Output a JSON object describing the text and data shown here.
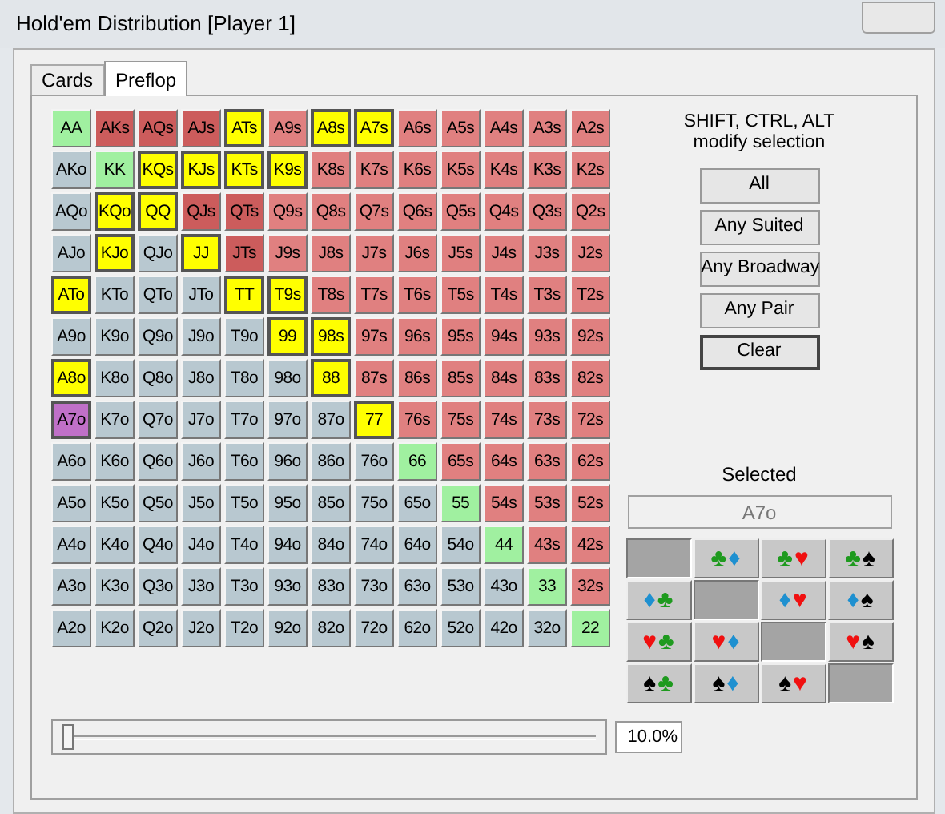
{
  "window": {
    "title": "Hold'em Distribution [Player 1]"
  },
  "tabs": [
    {
      "label": "Cards",
      "selected": false
    },
    {
      "label": "Preflop",
      "selected": true
    }
  ],
  "hand_grid": [
    [
      {
        "label": "AA",
        "color": "#a0f0a0",
        "selected": false
      },
      {
        "label": "AKs",
        "color": "#cc5c5c",
        "selected": false
      },
      {
        "label": "AQs",
        "color": "#cc5c5c",
        "selected": false
      },
      {
        "label": "AJs",
        "color": "#cc5c5c",
        "selected": false
      },
      {
        "label": "ATs",
        "color": "#ffff00",
        "selected": true
      },
      {
        "label": "A9s",
        "color": "#e08080",
        "selected": false
      },
      {
        "label": "A8s",
        "color": "#ffff00",
        "selected": true
      },
      {
        "label": "A7s",
        "color": "#ffff00",
        "selected": true
      },
      {
        "label": "A6s",
        "color": "#e08080",
        "selected": false
      },
      {
        "label": "A5s",
        "color": "#e08080",
        "selected": false
      },
      {
        "label": "A4s",
        "color": "#e08080",
        "selected": false
      },
      {
        "label": "A3s",
        "color": "#e08080",
        "selected": false
      },
      {
        "label": "A2s",
        "color": "#e08080",
        "selected": false
      }
    ],
    [
      {
        "label": "AKo",
        "color": "#b8c8d0",
        "selected": false
      },
      {
        "label": "KK",
        "color": "#a0f0a0",
        "selected": false
      },
      {
        "label": "KQs",
        "color": "#ffff00",
        "selected": true
      },
      {
        "label": "KJs",
        "color": "#ffff00",
        "selected": true
      },
      {
        "label": "KTs",
        "color": "#ffff00",
        "selected": true
      },
      {
        "label": "K9s",
        "color": "#ffff00",
        "selected": true
      },
      {
        "label": "K8s",
        "color": "#e08080",
        "selected": false
      },
      {
        "label": "K7s",
        "color": "#e08080",
        "selected": false
      },
      {
        "label": "K6s",
        "color": "#e08080",
        "selected": false
      },
      {
        "label": "K5s",
        "color": "#e08080",
        "selected": false
      },
      {
        "label": "K4s",
        "color": "#e08080",
        "selected": false
      },
      {
        "label": "K3s",
        "color": "#e08080",
        "selected": false
      },
      {
        "label": "K2s",
        "color": "#e08080",
        "selected": false
      }
    ],
    [
      {
        "label": "AQo",
        "color": "#b8c8d0",
        "selected": false
      },
      {
        "label": "KQo",
        "color": "#ffff00",
        "selected": true
      },
      {
        "label": "QQ",
        "color": "#ffff00",
        "selected": true
      },
      {
        "label": "QJs",
        "color": "#cc5c5c",
        "selected": false
      },
      {
        "label": "QTs",
        "color": "#cc5c5c",
        "selected": false
      },
      {
        "label": "Q9s",
        "color": "#e08080",
        "selected": false
      },
      {
        "label": "Q8s",
        "color": "#e08080",
        "selected": false
      },
      {
        "label": "Q7s",
        "color": "#e08080",
        "selected": false
      },
      {
        "label": "Q6s",
        "color": "#e08080",
        "selected": false
      },
      {
        "label": "Q5s",
        "color": "#e08080",
        "selected": false
      },
      {
        "label": "Q4s",
        "color": "#e08080",
        "selected": false
      },
      {
        "label": "Q3s",
        "color": "#e08080",
        "selected": false
      },
      {
        "label": "Q2s",
        "color": "#e08080",
        "selected": false
      }
    ],
    [
      {
        "label": "AJo",
        "color": "#b8c8d0",
        "selected": false
      },
      {
        "label": "KJo",
        "color": "#ffff00",
        "selected": true
      },
      {
        "label": "QJo",
        "color": "#b8c8d0",
        "selected": false
      },
      {
        "label": "JJ",
        "color": "#ffff00",
        "selected": true
      },
      {
        "label": "JTs",
        "color": "#cc5c5c",
        "selected": false
      },
      {
        "label": "J9s",
        "color": "#e08080",
        "selected": false
      },
      {
        "label": "J8s",
        "color": "#e08080",
        "selected": false
      },
      {
        "label": "J7s",
        "color": "#e08080",
        "selected": false
      },
      {
        "label": "J6s",
        "color": "#e08080",
        "selected": false
      },
      {
        "label": "J5s",
        "color": "#e08080",
        "selected": false
      },
      {
        "label": "J4s",
        "color": "#e08080",
        "selected": false
      },
      {
        "label": "J3s",
        "color": "#e08080",
        "selected": false
      },
      {
        "label": "J2s",
        "color": "#e08080",
        "selected": false
      }
    ],
    [
      {
        "label": "ATo",
        "color": "#ffff00",
        "selected": true
      },
      {
        "label": "KTo",
        "color": "#b8c8d0",
        "selected": false
      },
      {
        "label": "QTo",
        "color": "#b8c8d0",
        "selected": false
      },
      {
        "label": "JTo",
        "color": "#b8c8d0",
        "selected": false
      },
      {
        "label": "TT",
        "color": "#ffff00",
        "selected": true
      },
      {
        "label": "T9s",
        "color": "#ffff00",
        "selected": true
      },
      {
        "label": "T8s",
        "color": "#e08080",
        "selected": false
      },
      {
        "label": "T7s",
        "color": "#e08080",
        "selected": false
      },
      {
        "label": "T6s",
        "color": "#e08080",
        "selected": false
      },
      {
        "label": "T5s",
        "color": "#e08080",
        "selected": false
      },
      {
        "label": "T4s",
        "color": "#e08080",
        "selected": false
      },
      {
        "label": "T3s",
        "color": "#e08080",
        "selected": false
      },
      {
        "label": "T2s",
        "color": "#e08080",
        "selected": false
      }
    ],
    [
      {
        "label": "A9o",
        "color": "#b8c8d0",
        "selected": false
      },
      {
        "label": "K9o",
        "color": "#b8c8d0",
        "selected": false
      },
      {
        "label": "Q9o",
        "color": "#b8c8d0",
        "selected": false
      },
      {
        "label": "J9o",
        "color": "#b8c8d0",
        "selected": false
      },
      {
        "label": "T9o",
        "color": "#b8c8d0",
        "selected": false
      },
      {
        "label": "99",
        "color": "#ffff00",
        "selected": true
      },
      {
        "label": "98s",
        "color": "#ffff00",
        "selected": true
      },
      {
        "label": "97s",
        "color": "#e08080",
        "selected": false
      },
      {
        "label": "96s",
        "color": "#e08080",
        "selected": false
      },
      {
        "label": "95s",
        "color": "#e08080",
        "selected": false
      },
      {
        "label": "94s",
        "color": "#e08080",
        "selected": false
      },
      {
        "label": "93s",
        "color": "#e08080",
        "selected": false
      },
      {
        "label": "92s",
        "color": "#e08080",
        "selected": false
      }
    ],
    [
      {
        "label": "A8o",
        "color": "#ffff00",
        "selected": true
      },
      {
        "label": "K8o",
        "color": "#b8c8d0",
        "selected": false
      },
      {
        "label": "Q8o",
        "color": "#b8c8d0",
        "selected": false
      },
      {
        "label": "J8o",
        "color": "#b8c8d0",
        "selected": false
      },
      {
        "label": "T8o",
        "color": "#b8c8d0",
        "selected": false
      },
      {
        "label": "98o",
        "color": "#b8c8d0",
        "selected": false
      },
      {
        "label": "88",
        "color": "#ffff00",
        "selected": true
      },
      {
        "label": "87s",
        "color": "#e08080",
        "selected": false
      },
      {
        "label": "86s",
        "color": "#e08080",
        "selected": false
      },
      {
        "label": "85s",
        "color": "#e08080",
        "selected": false
      },
      {
        "label": "84s",
        "color": "#e08080",
        "selected": false
      },
      {
        "label": "83s",
        "color": "#e08080",
        "selected": false
      },
      {
        "label": "82s",
        "color": "#e08080",
        "selected": false
      }
    ],
    [
      {
        "label": "A7o",
        "color": "#c070c8",
        "selected": true
      },
      {
        "label": "K7o",
        "color": "#b8c8d0",
        "selected": false
      },
      {
        "label": "Q7o",
        "color": "#b8c8d0",
        "selected": false
      },
      {
        "label": "J7o",
        "color": "#b8c8d0",
        "selected": false
      },
      {
        "label": "T7o",
        "color": "#b8c8d0",
        "selected": false
      },
      {
        "label": "97o",
        "color": "#b8c8d0",
        "selected": false
      },
      {
        "label": "87o",
        "color": "#b8c8d0",
        "selected": false
      },
      {
        "label": "77",
        "color": "#ffff00",
        "selected": true
      },
      {
        "label": "76s",
        "color": "#e08080",
        "selected": false
      },
      {
        "label": "75s",
        "color": "#e08080",
        "selected": false
      },
      {
        "label": "74s",
        "color": "#e08080",
        "selected": false
      },
      {
        "label": "73s",
        "color": "#e08080",
        "selected": false
      },
      {
        "label": "72s",
        "color": "#e08080",
        "selected": false
      }
    ],
    [
      {
        "label": "A6o",
        "color": "#b8c8d0",
        "selected": false
      },
      {
        "label": "K6o",
        "color": "#b8c8d0",
        "selected": false
      },
      {
        "label": "Q6o",
        "color": "#b8c8d0",
        "selected": false
      },
      {
        "label": "J6o",
        "color": "#b8c8d0",
        "selected": false
      },
      {
        "label": "T6o",
        "color": "#b8c8d0",
        "selected": false
      },
      {
        "label": "96o",
        "color": "#b8c8d0",
        "selected": false
      },
      {
        "label": "86o",
        "color": "#b8c8d0",
        "selected": false
      },
      {
        "label": "76o",
        "color": "#b8c8d0",
        "selected": false
      },
      {
        "label": "66",
        "color": "#a0f0a0",
        "selected": false
      },
      {
        "label": "65s",
        "color": "#e08080",
        "selected": false
      },
      {
        "label": "64s",
        "color": "#e08080",
        "selected": false
      },
      {
        "label": "63s",
        "color": "#e08080",
        "selected": false
      },
      {
        "label": "62s",
        "color": "#e08080",
        "selected": false
      }
    ],
    [
      {
        "label": "A5o",
        "color": "#b8c8d0",
        "selected": false
      },
      {
        "label": "K5o",
        "color": "#b8c8d0",
        "selected": false
      },
      {
        "label": "Q5o",
        "color": "#b8c8d0",
        "selected": false
      },
      {
        "label": "J5o",
        "color": "#b8c8d0",
        "selected": false
      },
      {
        "label": "T5o",
        "color": "#b8c8d0",
        "selected": false
      },
      {
        "label": "95o",
        "color": "#b8c8d0",
        "selected": false
      },
      {
        "label": "85o",
        "color": "#b8c8d0",
        "selected": false
      },
      {
        "label": "75o",
        "color": "#b8c8d0",
        "selected": false
      },
      {
        "label": "65o",
        "color": "#b8c8d0",
        "selected": false
      },
      {
        "label": "55",
        "color": "#a0f0a0",
        "selected": false
      },
      {
        "label": "54s",
        "color": "#e08080",
        "selected": false
      },
      {
        "label": "53s",
        "color": "#e08080",
        "selected": false
      },
      {
        "label": "52s",
        "color": "#e08080",
        "selected": false
      }
    ],
    [
      {
        "label": "A4o",
        "color": "#b8c8d0",
        "selected": false
      },
      {
        "label": "K4o",
        "color": "#b8c8d0",
        "selected": false
      },
      {
        "label": "Q4o",
        "color": "#b8c8d0",
        "selected": false
      },
      {
        "label": "J4o",
        "color": "#b8c8d0",
        "selected": false
      },
      {
        "label": "T4o",
        "color": "#b8c8d0",
        "selected": false
      },
      {
        "label": "94o",
        "color": "#b8c8d0",
        "selected": false
      },
      {
        "label": "84o",
        "color": "#b8c8d0",
        "selected": false
      },
      {
        "label": "74o",
        "color": "#b8c8d0",
        "selected": false
      },
      {
        "label": "64o",
        "color": "#b8c8d0",
        "selected": false
      },
      {
        "label": "54o",
        "color": "#b8c8d0",
        "selected": false
      },
      {
        "label": "44",
        "color": "#a0f0a0",
        "selected": false
      },
      {
        "label": "43s",
        "color": "#e08080",
        "selected": false
      },
      {
        "label": "42s",
        "color": "#e08080",
        "selected": false
      }
    ],
    [
      {
        "label": "A3o",
        "color": "#b8c8d0",
        "selected": false
      },
      {
        "label": "K3o",
        "color": "#b8c8d0",
        "selected": false
      },
      {
        "label": "Q3o",
        "color": "#b8c8d0",
        "selected": false
      },
      {
        "label": "J3o",
        "color": "#b8c8d0",
        "selected": false
      },
      {
        "label": "T3o",
        "color": "#b8c8d0",
        "selected": false
      },
      {
        "label": "93o",
        "color": "#b8c8d0",
        "selected": false
      },
      {
        "label": "83o",
        "color": "#b8c8d0",
        "selected": false
      },
      {
        "label": "73o",
        "color": "#b8c8d0",
        "selected": false
      },
      {
        "label": "63o",
        "color": "#b8c8d0",
        "selected": false
      },
      {
        "label": "53o",
        "color": "#b8c8d0",
        "selected": false
      },
      {
        "label": "43o",
        "color": "#b8c8d0",
        "selected": false
      },
      {
        "label": "33",
        "color": "#a0f0a0",
        "selected": false
      },
      {
        "label": "32s",
        "color": "#e08080",
        "selected": false
      }
    ],
    [
      {
        "label": "A2o",
        "color": "#b8c8d0",
        "selected": false
      },
      {
        "label": "K2o",
        "color": "#b8c8d0",
        "selected": false
      },
      {
        "label": "Q2o",
        "color": "#b8c8d0",
        "selected": false
      },
      {
        "label": "J2o",
        "color": "#b8c8d0",
        "selected": false
      },
      {
        "label": "T2o",
        "color": "#b8c8d0",
        "selected": false
      },
      {
        "label": "92o",
        "color": "#b8c8d0",
        "selected": false
      },
      {
        "label": "82o",
        "color": "#b8c8d0",
        "selected": false
      },
      {
        "label": "72o",
        "color": "#b8c8d0",
        "selected": false
      },
      {
        "label": "62o",
        "color": "#b8c8d0",
        "selected": false
      },
      {
        "label": "52o",
        "color": "#b8c8d0",
        "selected": false
      },
      {
        "label": "42o",
        "color": "#b8c8d0",
        "selected": false
      },
      {
        "label": "32o",
        "color": "#b8c8d0",
        "selected": false
      },
      {
        "label": "22",
        "color": "#a0f0a0",
        "selected": false
      }
    ]
  ],
  "hint": {
    "line_1": "SHIFT, CTRL, ALT",
    "line_2": "modify selection"
  },
  "buttons": [
    {
      "label": "All",
      "selected": false
    },
    {
      "label": "Any Suited",
      "selected": false
    },
    {
      "label": "Any Broadway",
      "selected": false
    },
    {
      "label": "Any Pair",
      "selected": false
    },
    {
      "label": "Clear",
      "selected": true
    }
  ],
  "selected_label": "Selected",
  "selected_value": "A7o",
  "suit_grid": [
    [
      {
        "kind": "empty"
      },
      {
        "kind": "combo",
        "suits": [
          {
            "symbol": "♣",
            "color": "#1e9a1e"
          },
          {
            "symbol": "♦",
            "color": "#1e90d0"
          }
        ]
      },
      {
        "kind": "combo",
        "suits": [
          {
            "symbol": "♣",
            "color": "#1e9a1e"
          },
          {
            "symbol": "♥",
            "color": "#f01010"
          }
        ]
      },
      {
        "kind": "combo",
        "suits": [
          {
            "symbol": "♣",
            "color": "#1e9a1e"
          },
          {
            "symbol": "♠",
            "color": "#000000"
          }
        ]
      }
    ],
    [
      {
        "kind": "combo",
        "suits": [
          {
            "symbol": "♦",
            "color": "#1e90d0"
          },
          {
            "symbol": "♣",
            "color": "#1e9a1e"
          }
        ]
      },
      {
        "kind": "empty"
      },
      {
        "kind": "combo",
        "suits": [
          {
            "symbol": "♦",
            "color": "#1e90d0"
          },
          {
            "symbol": "♥",
            "color": "#f01010"
          }
        ]
      },
      {
        "kind": "combo",
        "suits": [
          {
            "symbol": "♦",
            "color": "#1e90d0"
          },
          {
            "symbol": "♠",
            "color": "#000000"
          }
        ]
      }
    ],
    [
      {
        "kind": "combo",
        "suits": [
          {
            "symbol": "♥",
            "color": "#f01010"
          },
          {
            "symbol": "♣",
            "color": "#1e9a1e"
          }
        ]
      },
      {
        "kind": "combo",
        "suits": [
          {
            "symbol": "♥",
            "color": "#f01010"
          },
          {
            "symbol": "♦",
            "color": "#1e90d0"
          }
        ]
      },
      {
        "kind": "empty"
      },
      {
        "kind": "combo",
        "suits": [
          {
            "symbol": "♥",
            "color": "#f01010"
          },
          {
            "symbol": "♠",
            "color": "#000000"
          }
        ]
      }
    ],
    [
      {
        "kind": "combo",
        "suits": [
          {
            "symbol": "♠",
            "color": "#000000"
          },
          {
            "symbol": "♣",
            "color": "#1e9a1e"
          }
        ]
      },
      {
        "kind": "combo",
        "suits": [
          {
            "symbol": "♠",
            "color": "#000000"
          },
          {
            "symbol": "♦",
            "color": "#1e90d0"
          }
        ]
      },
      {
        "kind": "combo",
        "suits": [
          {
            "symbol": "♠",
            "color": "#000000"
          },
          {
            "symbol": "♥",
            "color": "#f01010"
          }
        ]
      },
      {
        "kind": "empty"
      }
    ]
  ],
  "range_slider": {
    "level": 0.01,
    "reading": "10.0%"
  }
}
